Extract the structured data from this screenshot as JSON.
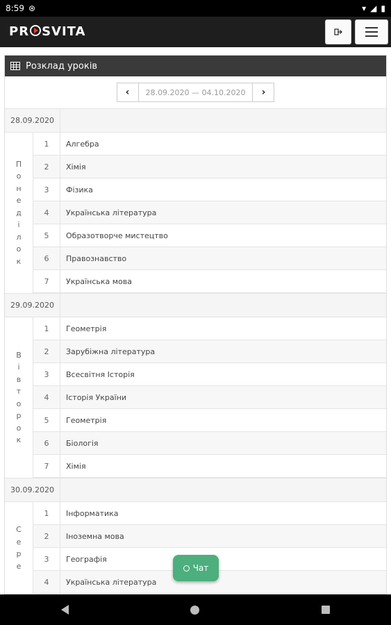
{
  "status_bar": {
    "time": "8:59",
    "battery": "▮"
  },
  "app": {
    "logo": "PROSVITA",
    "logo_prefix": "PR",
    "logo_suffix": "SVITA",
    "logout_icon": "logout-icon",
    "menu_icon": "hamburger-icon"
  },
  "panel": {
    "title": "Розклад уроків",
    "date_range": "28.09.2020 — 04.10.2020",
    "prev": "‹",
    "next": "›"
  },
  "schedule": [
    {
      "date": "28.09.2020",
      "weekday_letters": [
        "П",
        "о",
        "н",
        "е",
        "д",
        "і",
        "л",
        "о",
        "к"
      ],
      "lessons": [
        {
          "num": "1",
          "subject": "Алгебра"
        },
        {
          "num": "2",
          "subject": "Хімія"
        },
        {
          "num": "3",
          "subject": "Фізика"
        },
        {
          "num": "4",
          "subject": "Українська література"
        },
        {
          "num": "5",
          "subject": "Образотворче мистецтво"
        },
        {
          "num": "6",
          "subject": "Правознавство"
        },
        {
          "num": "7",
          "subject": "Українська мова"
        }
      ]
    },
    {
      "date": "29.09.2020",
      "weekday_letters": [
        "В",
        "і",
        "в",
        "т",
        "о",
        "р",
        "о",
        "к"
      ],
      "lessons": [
        {
          "num": "1",
          "subject": "Геометрія"
        },
        {
          "num": "2",
          "subject": "Зарубіжна література"
        },
        {
          "num": "3",
          "subject": "Всесвітня Історія"
        },
        {
          "num": "4",
          "subject": "Історія України"
        },
        {
          "num": "5",
          "subject": "Геометрія"
        },
        {
          "num": "6",
          "subject": "Біологія"
        },
        {
          "num": "7",
          "subject": "Хімія"
        }
      ]
    },
    {
      "date": "30.09.2020",
      "weekday_letters": [
        "С",
        "е",
        "р",
        "е"
      ],
      "lessons": [
        {
          "num": "1",
          "subject": "Інформатика"
        },
        {
          "num": "2",
          "subject": "Іноземна мова"
        },
        {
          "num": "3",
          "subject": "Географія"
        },
        {
          "num": "4",
          "subject": "Українська література"
        }
      ]
    }
  ],
  "chat": {
    "label": "Чат"
  },
  "colors": {
    "header": "#1e1e1e",
    "panel_head": "#3a3a3a",
    "chat": "#4caf7d",
    "logo_accent": "#e53935"
  }
}
